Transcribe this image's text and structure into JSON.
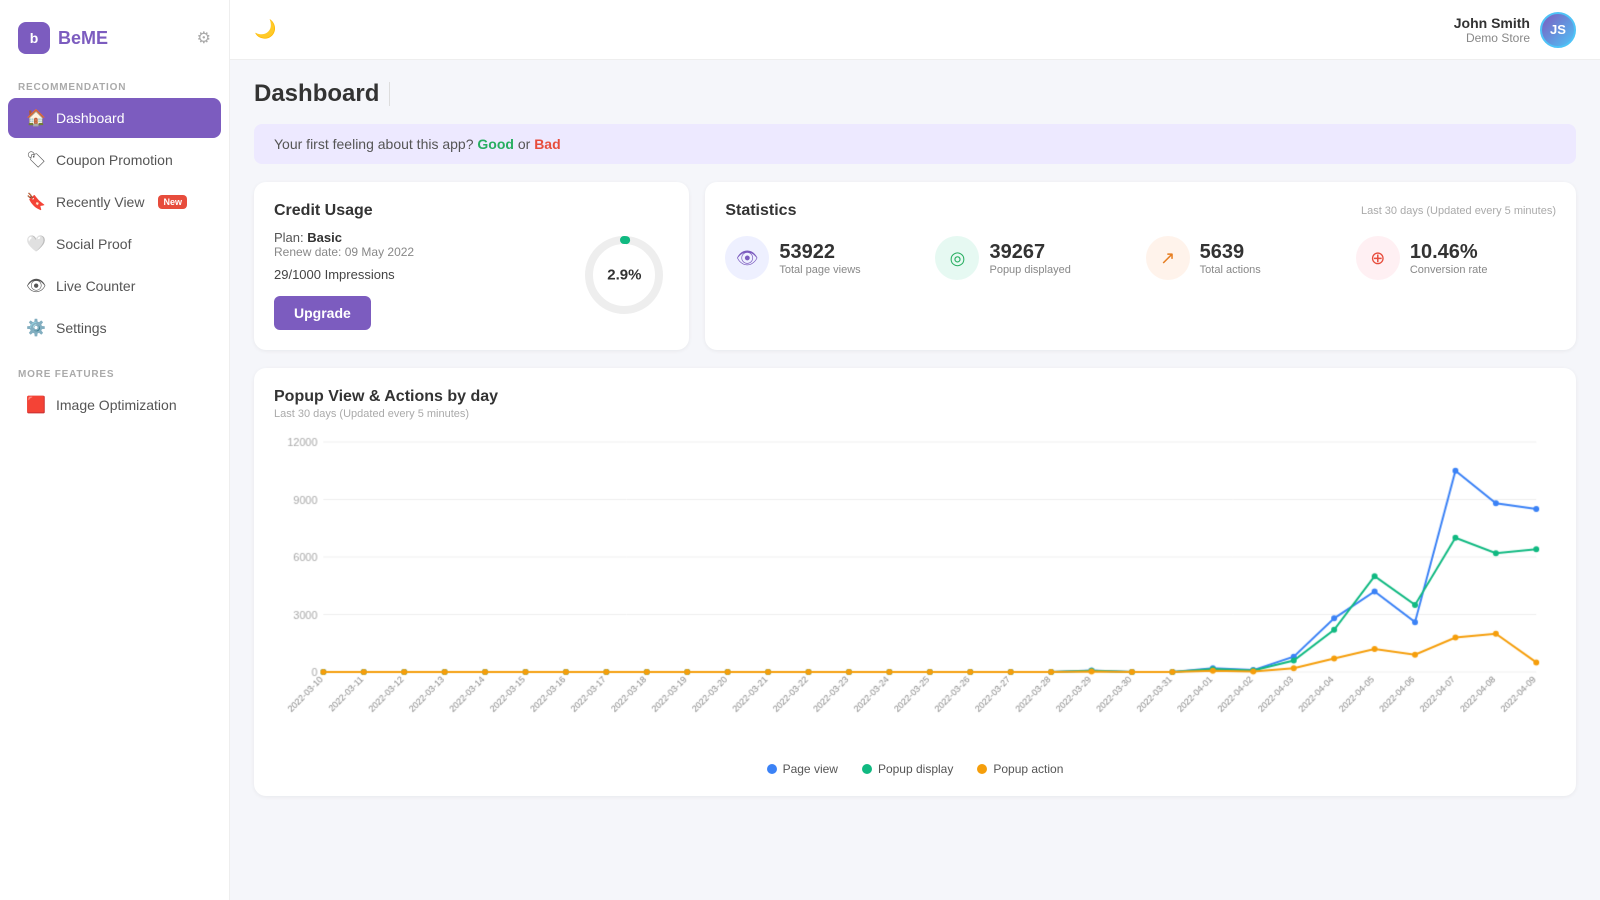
{
  "app": {
    "logo_letter": "b",
    "logo_name": "BeME"
  },
  "sidebar": {
    "recommendation_label": "RECOMMENDATION",
    "more_features_label": "MORE FEATURES",
    "items": [
      {
        "id": "dashboard",
        "label": "Dashboard",
        "icon": "🏠",
        "active": true
      },
      {
        "id": "coupon",
        "label": "Coupon Promotion",
        "icon": "🏷️",
        "active": false
      },
      {
        "id": "recently-view",
        "label": "Recently View",
        "icon": "🔖",
        "active": false,
        "badge": "New"
      },
      {
        "id": "social-proof",
        "label": "Social Proof",
        "icon": "🤍",
        "active": false
      },
      {
        "id": "live-counter",
        "label": "Live Counter",
        "icon": "👁️",
        "active": false
      }
    ],
    "more_items": [
      {
        "id": "image-optimization",
        "label": "Image Optimization",
        "icon": "🟥",
        "active": false
      }
    ]
  },
  "header": {
    "moon_icon": "🌙",
    "user_name": "John Smith",
    "user_store": "Demo Store",
    "avatar_initials": "JS"
  },
  "page": {
    "title": "Dashboard"
  },
  "feedback_banner": {
    "text_prefix": "Your first feeling about this app?",
    "good_label": "Good",
    "or_label": "or",
    "bad_label": "Bad"
  },
  "credit_usage": {
    "title": "Credit Usage",
    "plan_label": "Plan:",
    "plan_name": "Basic",
    "renew_date": "Renew date: 09 May 2022",
    "impressions": "29/1000 Impressions",
    "percentage": "2.9%",
    "upgrade_label": "Upgrade",
    "donut_percent": 2.9
  },
  "statistics": {
    "title": "Statistics",
    "last_update": "Last 30 days (Updated every 5 minutes)",
    "metrics": [
      {
        "id": "page-views",
        "value": "53922",
        "label": "Total page views",
        "icon_type": "blue",
        "icon": "👁"
      },
      {
        "id": "popup-displayed",
        "value": "39267",
        "label": "Popup displayed",
        "icon_type": "green",
        "icon": "◎"
      },
      {
        "id": "total-actions",
        "value": "5639",
        "label": "Total actions",
        "icon_type": "orange",
        "icon": "↗"
      },
      {
        "id": "conversion-rate",
        "value": "10.46%",
        "label": "Conversion rate",
        "icon_type": "pink",
        "icon": "⊕"
      }
    ]
  },
  "chart": {
    "title": "Popup View & Actions by day",
    "subtitle": "Last 30 days (Updated every 5 minutes)",
    "y_labels": [
      "12000",
      "9000",
      "6000",
      "3000",
      "0"
    ],
    "legend": [
      {
        "label": "Page view",
        "color": "#3b82f6"
      },
      {
        "label": "Popup display",
        "color": "#10b981"
      },
      {
        "label": "Popup action",
        "color": "#f59e0b"
      }
    ],
    "x_labels": [
      "2022-03-10",
      "2022-03-11",
      "2022-03-12",
      "2022-03-13",
      "2022-03-14",
      "2022-03-15",
      "2022-03-16",
      "2022-03-17",
      "2022-03-18",
      "2022-03-19",
      "2022-03-20",
      "2022-03-21",
      "2022-03-22",
      "2022-03-23",
      "2022-03-24",
      "2022-03-25",
      "2022-03-26",
      "2022-03-27",
      "2022-03-28",
      "2022-03-29",
      "2022-03-30",
      "2022-03-31",
      "2022-04-01",
      "2022-04-02",
      "2022-04-03",
      "2022-04-04",
      "2022-04-05",
      "2022-04-06",
      "2022-04-07",
      "2022-04-08",
      "2022-04-09"
    ]
  },
  "settings": {
    "label": "Settings",
    "icon": "⚙️"
  }
}
